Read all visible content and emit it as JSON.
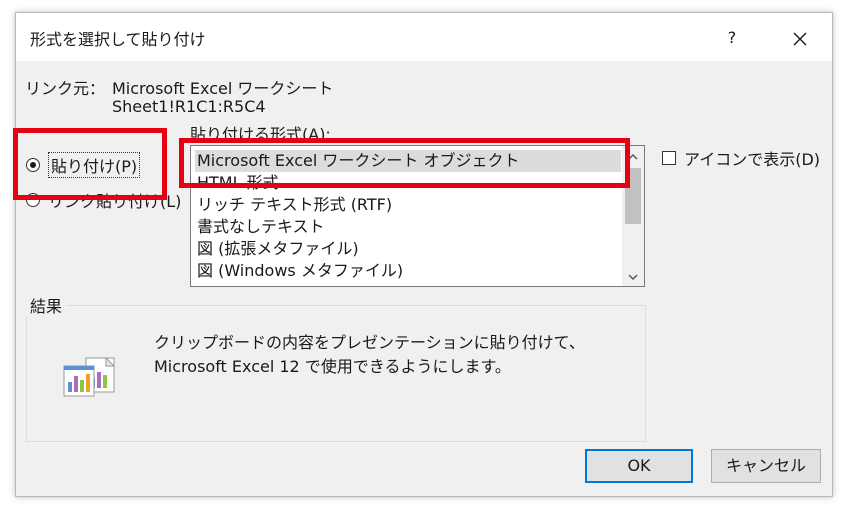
{
  "dialog": {
    "title": "形式を選択して貼り付け",
    "help": "?",
    "close_icon": "close-icon"
  },
  "source": {
    "label": "リンク元：",
    "value_line1": "Microsoft Excel ワークシート",
    "value_line2": "Sheet1!R1C1:R5C4"
  },
  "paste_options": [
    {
      "label": "貼り付け(P)",
      "checked": true
    },
    {
      "label": "リンク貼り付け(L)",
      "checked": false
    }
  ],
  "format": {
    "label": "貼り付ける形式(A):",
    "items": [
      "Microsoft Excel ワークシート オブジェクト",
      "HTML 形式",
      "リッチ テキスト形式 (RTF)",
      "書式なしテキスト",
      "図 (拡張メタファイル)",
      "図 (Windows メタファイル)"
    ],
    "selected_index": 0
  },
  "display_as_icon": {
    "label": "アイコンで表示(D)",
    "checked": false
  },
  "result": {
    "label": "結果",
    "text": "クリップボードの内容をプレゼンテーションに貼り付けて、Microsoft Excel 12 で使用できるようにします。",
    "icon": "paste-chart-icon"
  },
  "buttons": {
    "ok": "OK",
    "cancel": "キャンセル"
  },
  "colors": {
    "highlight": "#e60012",
    "ok_border": "#0078d7"
  }
}
